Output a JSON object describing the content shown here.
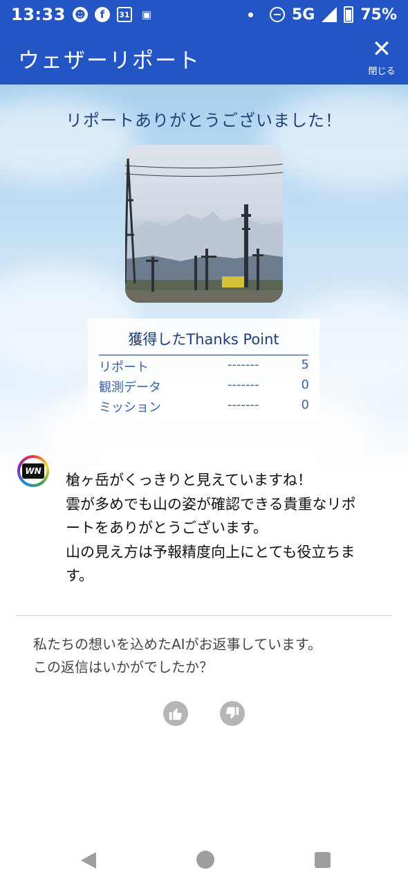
{
  "status_bar": {
    "time": "13:33",
    "network": "5G",
    "battery": "75%"
  },
  "app_bar": {
    "title": "ウェザーリポート",
    "close_label": "閉じる"
  },
  "thanks_message": "リポートありがとうございました！",
  "points": {
    "heading": "獲得したThanks Point",
    "rows": [
      {
        "label": "リポート",
        "dashes": "-------",
        "value": "5"
      },
      {
        "label": "観測データ",
        "dashes": "-------",
        "value": "0"
      },
      {
        "label": "ミッション",
        "dashes": "-------",
        "value": "0"
      }
    ]
  },
  "reply": {
    "avatar_text": "WN",
    "lines": [
      "槍ヶ岳がくっきりと見えていますね！",
      "雲が多めでも山の姿が確認できる貴重なリポ",
      "ートをありがとうございます。",
      "山の見え方は予報精度向上にとても役立ちま",
      "す。"
    ]
  },
  "feedback": {
    "lines": [
      "私たちの想いを込めたAIがお返事しています。",
      "この返信はいかがでしたか？"
    ]
  },
  "colors": {
    "app_bar": "#2356c4",
    "heading_text": "#1f3f77"
  }
}
